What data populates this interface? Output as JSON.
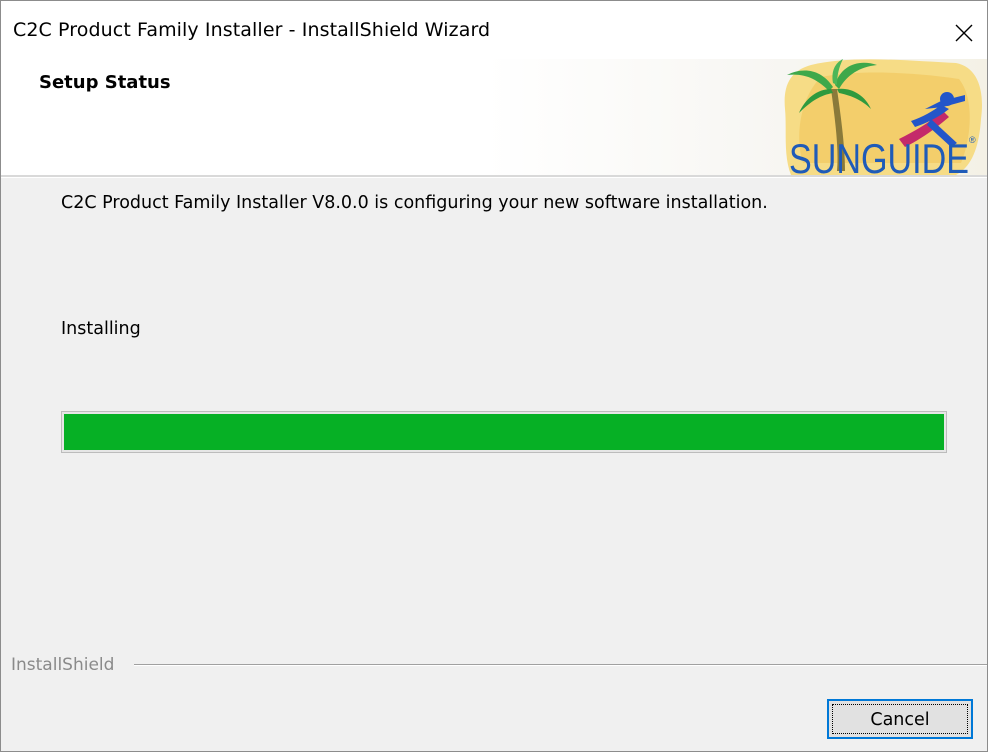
{
  "window": {
    "title": "C2C Product Family Installer - InstallShield Wizard",
    "close_icon": "close-icon"
  },
  "header": {
    "title": "Setup Status",
    "logo_icon": "sunguide-logo"
  },
  "main": {
    "status_message": "C2C Product Family Installer V8.0.0 is configuring your new software installation.",
    "progress_label": "Installing",
    "progress_fraction": 1.0,
    "progress_color": "#06b025"
  },
  "footer": {
    "brand": "InstallShield",
    "cancel_label": "Cancel"
  },
  "colors": {
    "window_bg": "#f0f0f0",
    "header_bg": "#ffffff",
    "button_focus": "#0078d7"
  }
}
